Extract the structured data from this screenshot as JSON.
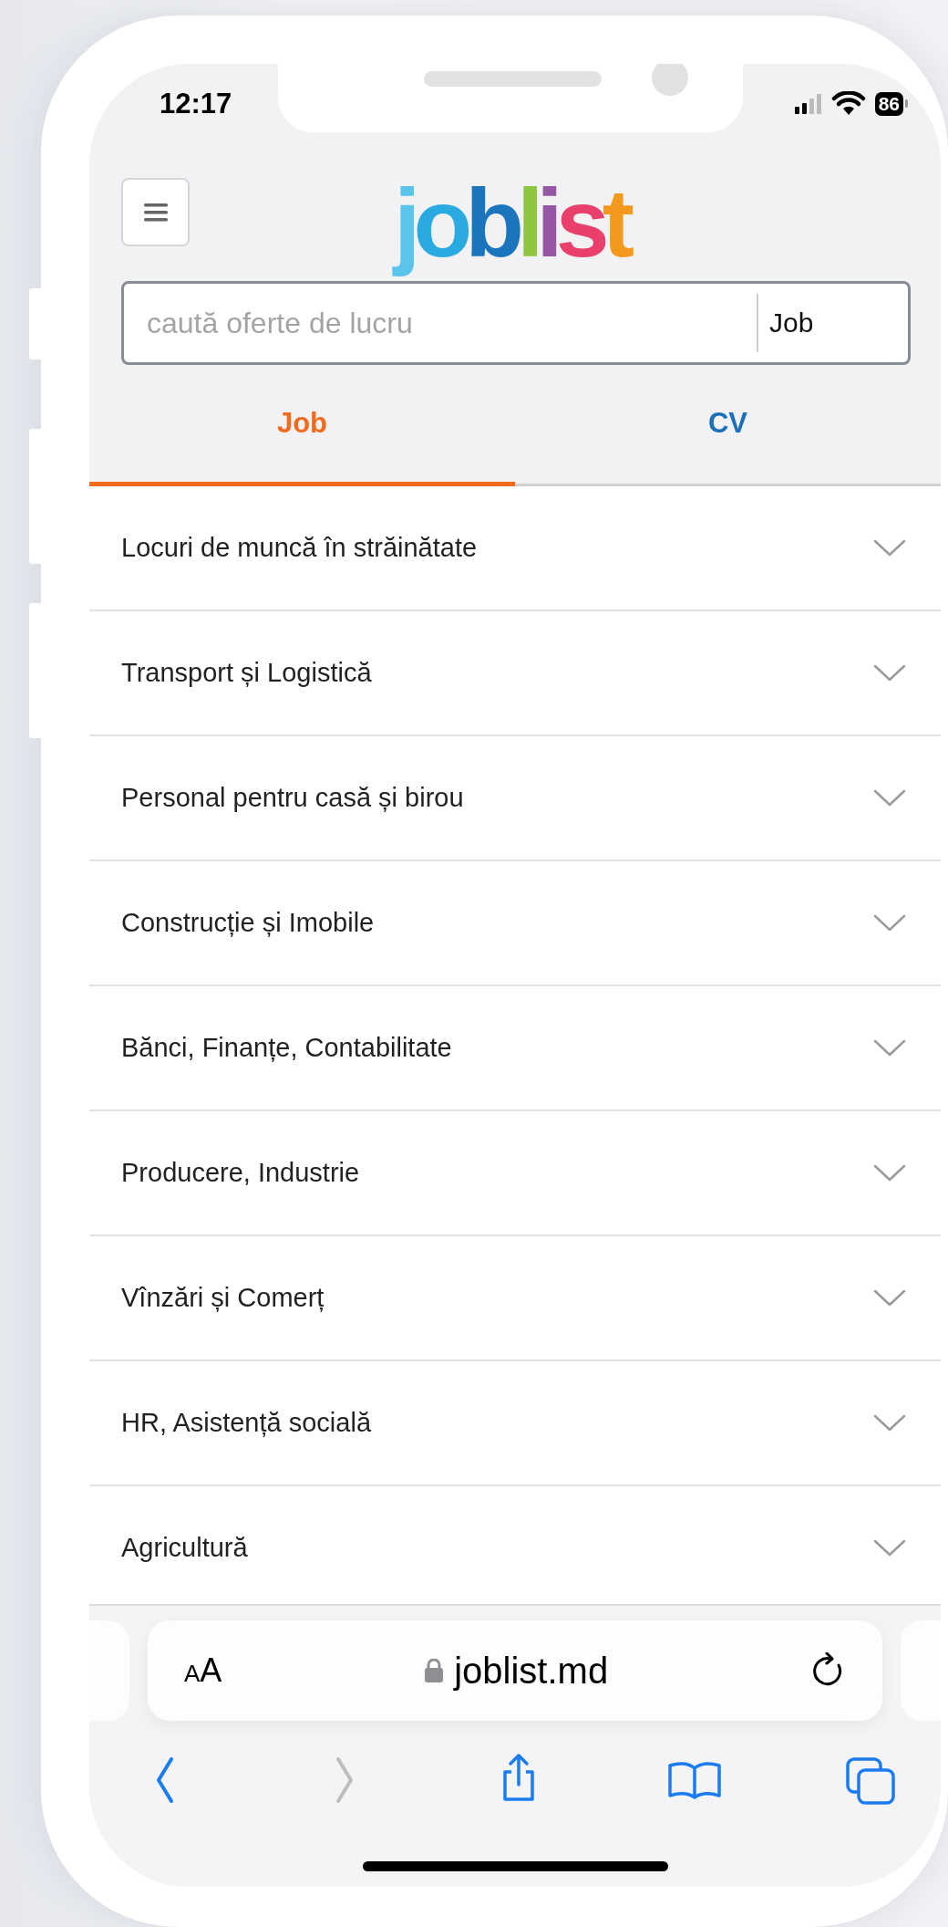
{
  "status_bar": {
    "time": "12:17",
    "battery": "86"
  },
  "header": {
    "logo": "joblist"
  },
  "search": {
    "placeholder": "caută oferte de lucru",
    "category": "Job"
  },
  "tabs": [
    {
      "label": "Job",
      "selected": true
    },
    {
      "label": "CV",
      "selected": false
    }
  ],
  "categories": [
    {
      "label": "Locuri de muncă în străinătate",
      "expanded": false
    },
    {
      "label": "Transport și Logistică",
      "expanded": false
    },
    {
      "label": "Personal pentru casă și birou",
      "expanded": false
    },
    {
      "label": "Construcție și Imobile",
      "expanded": false
    },
    {
      "label": "Bănci, Finanțe, Contabilitate",
      "expanded": false
    },
    {
      "label": "Producere, Industrie",
      "expanded": false
    },
    {
      "label": "Vînzări și Comerț",
      "expanded": false
    },
    {
      "label": "HR, Asistență socială",
      "expanded": false
    },
    {
      "label": "Agricultură",
      "expanded": false
    }
  ],
  "browser": {
    "text_size": "AA",
    "url": "joblist.md"
  },
  "toolbar": [
    {
      "kind": "back",
      "disabled": false
    },
    {
      "kind": "forward",
      "disabled": true
    },
    {
      "kind": "share",
      "disabled": false
    },
    {
      "kind": "bookmarks",
      "disabled": false
    },
    {
      "kind": "tabs",
      "disabled": false
    }
  ]
}
